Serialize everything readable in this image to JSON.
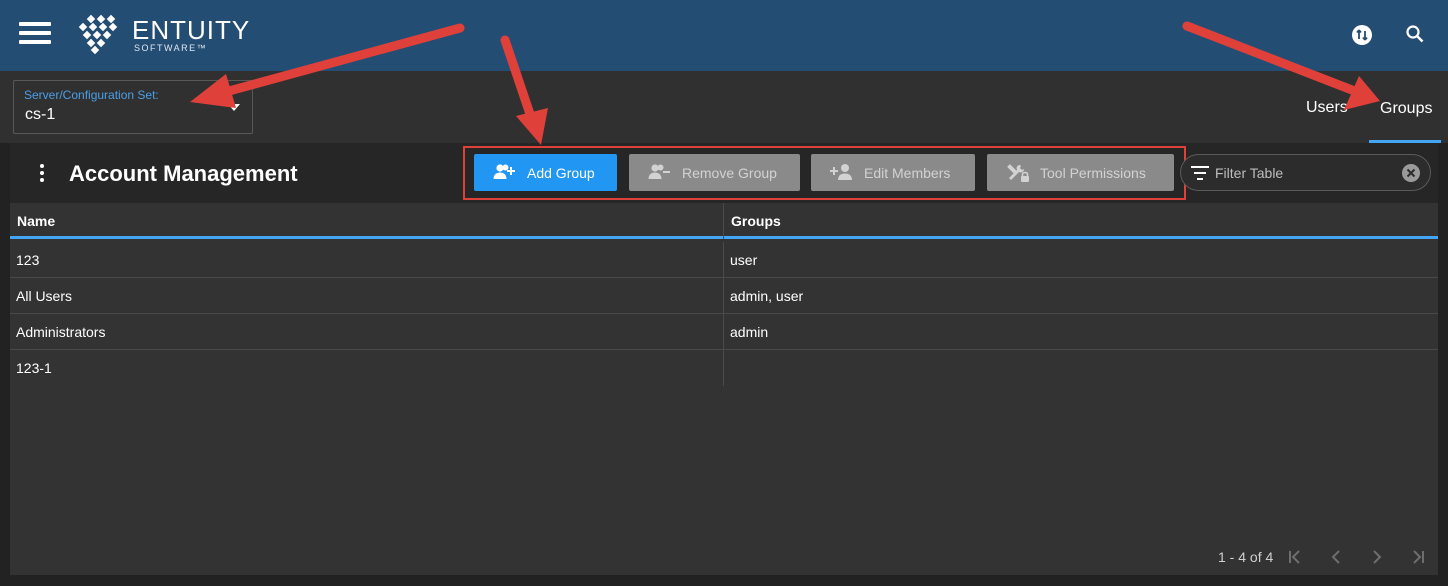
{
  "app": {
    "logo_text": "ENTUITY",
    "logo_sub": "SOFTWARE™"
  },
  "server": {
    "label": "Server/Configuration Set:",
    "value": "cs-1"
  },
  "tabs": [
    {
      "label": "Users",
      "active": false
    },
    {
      "label": "Groups",
      "active": true
    }
  ],
  "panel": {
    "title": "Account Management"
  },
  "toolbar": {
    "add_group": "Add Group",
    "remove_group": "Remove Group",
    "edit_members": "Edit Members",
    "tool_permissions": "Tool Permissions"
  },
  "filter": {
    "placeholder": "Filter Table"
  },
  "table": {
    "columns": [
      "Name",
      "Groups"
    ],
    "rows": [
      {
        "name": "123",
        "groups": "user"
      },
      {
        "name": "All Users",
        "groups": "admin, user"
      },
      {
        "name": "Administrators",
        "groups": "admin"
      },
      {
        "name": "123-1",
        "groups": ""
      }
    ]
  },
  "pagination": {
    "range": "1 - 4 of 4"
  },
  "colors": {
    "header": "#244d73",
    "accent": "#2196f3",
    "annotation": "#e0403a"
  }
}
